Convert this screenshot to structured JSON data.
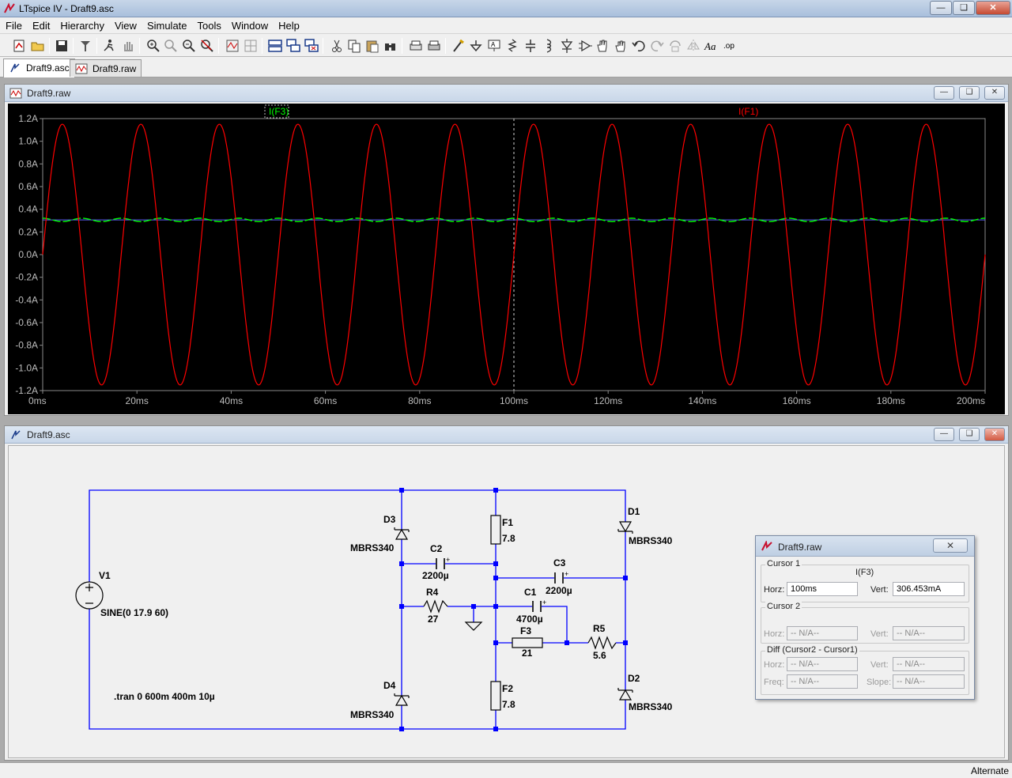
{
  "window": {
    "title": "LTspice IV - Draft9.asc",
    "minimize": "—",
    "restore": "❏",
    "close": "✕"
  },
  "menu": [
    "File",
    "Edit",
    "Hierarchy",
    "View",
    "Simulate",
    "Tools",
    "Window",
    "Help"
  ],
  "tabs": [
    {
      "label": "Draft9.asc",
      "active": true
    },
    {
      "label": "Draft9.raw",
      "active": false
    }
  ],
  "waveform_window": {
    "title": "Draft9.raw",
    "trace_labels": {
      "f3": "I(F3)",
      "f1": "I(F1)"
    }
  },
  "chart_data": {
    "type": "line",
    "xunit": "ms",
    "xlim": [
      0,
      200
    ],
    "ylim": [
      -1.2,
      1.2
    ],
    "x_ticks": [
      "0ms",
      "20ms",
      "40ms",
      "60ms",
      "80ms",
      "100ms",
      "120ms",
      "140ms",
      "160ms",
      "180ms",
      "200ms"
    ],
    "y_ticks": [
      "1.2A",
      "1.0A",
      "0.8A",
      "0.6A",
      "0.4A",
      "0.2A",
      "0.0A",
      "-0.2A",
      "-0.4A",
      "-0.6A",
      "-0.8A",
      "-1.0A",
      "-1.2A"
    ],
    "series": [
      {
        "name": "I(F1)",
        "color": "#ff0000",
        "kind": "sine",
        "amplitude": 1.15,
        "frequency_hz": 60,
        "phase_deg": 0
      },
      {
        "name": "I(F3)",
        "color": "#00ff00",
        "kind": "dc_ripple",
        "dc": 0.306,
        "ripple": 0.015
      }
    ],
    "cursor_x": 100,
    "grid": true
  },
  "schematic_window": {
    "title": "Draft9.asc",
    "labels": {
      "v1": "V1",
      "v1_value": "SINE(0 17.9 60)",
      "d3": "D3",
      "d3_model": "MBRS340",
      "d4": "D4",
      "d4_model": "MBRS340",
      "d1": "D1",
      "d1_model": "MBRS340",
      "d2": "D2",
      "d2_model": "MBRS340",
      "c2": "C2",
      "c2_value": "2200µ",
      "c3": "C3",
      "c3_value": "2200µ",
      "c1": "C1",
      "c1_value": "4700µ",
      "r4": "R4",
      "r4_value": "27",
      "r5": "R5",
      "r5_value": "5.6",
      "f1": "F1",
      "f1_value": "7.8",
      "f2": "F2",
      "f2_value": "7.8",
      "f3": "F3",
      "f3_value": "21",
      "directive": ".tran 0 600m 400m 10µ"
    }
  },
  "cursor_dialog": {
    "title": "Draft9.raw",
    "close": "✕",
    "cursor1": {
      "group": "Cursor 1",
      "trace": "I(F3)",
      "horz_label": "Horz:",
      "horz": "100ms",
      "vert_label": "Vert:",
      "vert": "306.453mA"
    },
    "cursor2": {
      "group": "Cursor 2",
      "horz_label": "Horz:",
      "horz": "-- N/A--",
      "vert_label": "Vert:",
      "vert": "-- N/A--"
    },
    "diff": {
      "group": "Diff (Cursor2 - Cursor1)",
      "horz_label": "Horz:",
      "horz": "-- N/A--",
      "vert_label": "Vert:",
      "vert": "-- N/A--",
      "freq_label": "Freq:",
      "freq": "-- N/A--",
      "slope_label": "Slope:",
      "slope": "-- N/A--"
    }
  },
  "status": {
    "right": "Alternate"
  },
  "toolbar_icons": [
    "new-schematic-icon",
    "open-icon",
    "save-icon",
    "control-panel-icon",
    "run-icon",
    "halt-icon",
    "zoom-in-icon",
    "zoom-full-icon",
    "zoom-out-icon",
    "zoom-cancel-icon",
    "autorange-icon",
    "grid-icon",
    "tile-horizontal-icon",
    "cascade-icon",
    "close-windows-icon",
    "cut-icon",
    "copy-icon",
    "paste-icon",
    "find-icon",
    "print-preview-icon",
    "print-icon",
    "wire-icon",
    "ground-icon",
    "label-net-icon",
    "resistor-icon",
    "capacitor-icon",
    "inductor-icon",
    "diode-icon",
    "component-icon",
    "move-icon",
    "drag-icon",
    "undo-icon",
    "redo-icon",
    "rotate-icon",
    "mirror-icon",
    "text-icon",
    "spice-directive-icon"
  ]
}
